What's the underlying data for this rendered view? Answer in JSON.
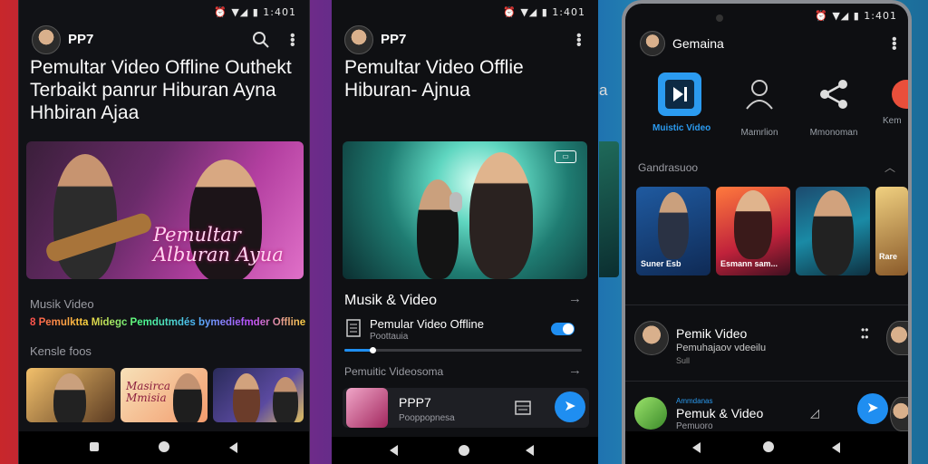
{
  "colors": {
    "accent": "#1f8ef1",
    "muted": "#9b9ca3"
  },
  "phone1": {
    "status": "⏰ ▼◢ ▮ 1:401",
    "app_name": "PP7",
    "headline": [
      "Pemultar Video Offline Outhekt",
      "Terbaikt panrur Hiburan Ayna",
      "Hhbiran Ajaa"
    ],
    "hero_overlay": [
      "Pemultar",
      "Alburan Ayua"
    ],
    "section_label": "Musik Video",
    "rainbow_text": "8 Pemulktta Midegc Pemdutmdés bymediefmder Offline",
    "section2_label": "Kensle foos",
    "thumb2_text": [
      "Masirca",
      "Mmisia"
    ]
  },
  "phone2": {
    "status": "⏰ ▼◢ ▮ 1:401",
    "app_name": "PP7",
    "headline": [
      "Pemultar Video Offlie",
      "Hiburan- Ajnua"
    ],
    "section_title": "Musik & Video",
    "player_title": "Pemular Video Offline",
    "player_sub": "Poottauia",
    "progress": 0.12,
    "section2_title": "Pemuitic Videosoma",
    "mini_title": "PPP7",
    "mini_sub": "Pooppopnesa"
  },
  "phone3": {
    "status": "⏰ ▼◢ ▮ 1:401",
    "app_name": "Gemaina",
    "categories": [
      {
        "label": "Muistic Video",
        "icon": "skip-next-icon"
      },
      {
        "label": "Mamrlion",
        "icon": "person-icon"
      },
      {
        "label": "Mmonoman",
        "icon": "share-icon"
      },
      {
        "label": "Kem",
        "icon": "circle-icon"
      }
    ],
    "section_label": "Gandrasuoo",
    "cards": [
      "Suner Esb",
      "Esmann sam...",
      "",
      ""
    ],
    "card4_text": "Rare",
    "row1": {
      "title": "Pemik Video",
      "sub": "Pemuhajaov vdeeilu",
      "meta": "Sull"
    },
    "row2": {
      "tag": "Ammdanas",
      "title": "Pemuk & Video",
      "sub": "Pemuoro"
    }
  }
}
